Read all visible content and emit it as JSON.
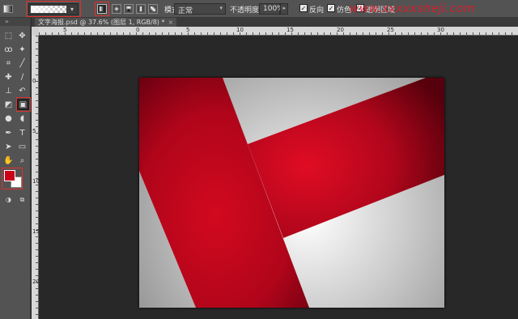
{
  "options_bar": {
    "mode_label": "模式:",
    "mode_value": "正常",
    "opacity_label": "不透明度:",
    "opacity_value": "100%",
    "reverse_label": "反向",
    "dither_label": "仿色",
    "transparency_label": "透明区域",
    "watermark": "www.xxxxxsheji.com"
  },
  "document": {
    "tab_title": "文字海报.psd @ 37.6% (图层 1, RGB/8) *",
    "close_glyph": "×"
  },
  "ruler": {
    "h_labels": [
      "5",
      "0",
      "5",
      "10",
      "15",
      "20",
      "25",
      "30"
    ],
    "v_labels": [
      "0",
      "5",
      "10",
      "15",
      "20"
    ]
  },
  "tools": {
    "panel_collapse": "»",
    "icons": [
      "move-icon",
      "marquee-icon",
      "lasso-icon",
      "magic-wand-icon",
      "crop-icon",
      "eyedropper-icon",
      "healing-brush-icon",
      "brush-icon",
      "clone-stamp-icon",
      "history-brush-icon",
      "eraser-icon",
      "gradient-icon",
      "blur-icon",
      "dodge-icon",
      "pen-icon",
      "type-icon",
      "path-select-icon",
      "shape-icon",
      "hand-icon",
      "zoom-icon"
    ]
  },
  "colors": {
    "foreground": "#cc0017",
    "background": "#ffffff",
    "highlight": "#e0302c"
  }
}
